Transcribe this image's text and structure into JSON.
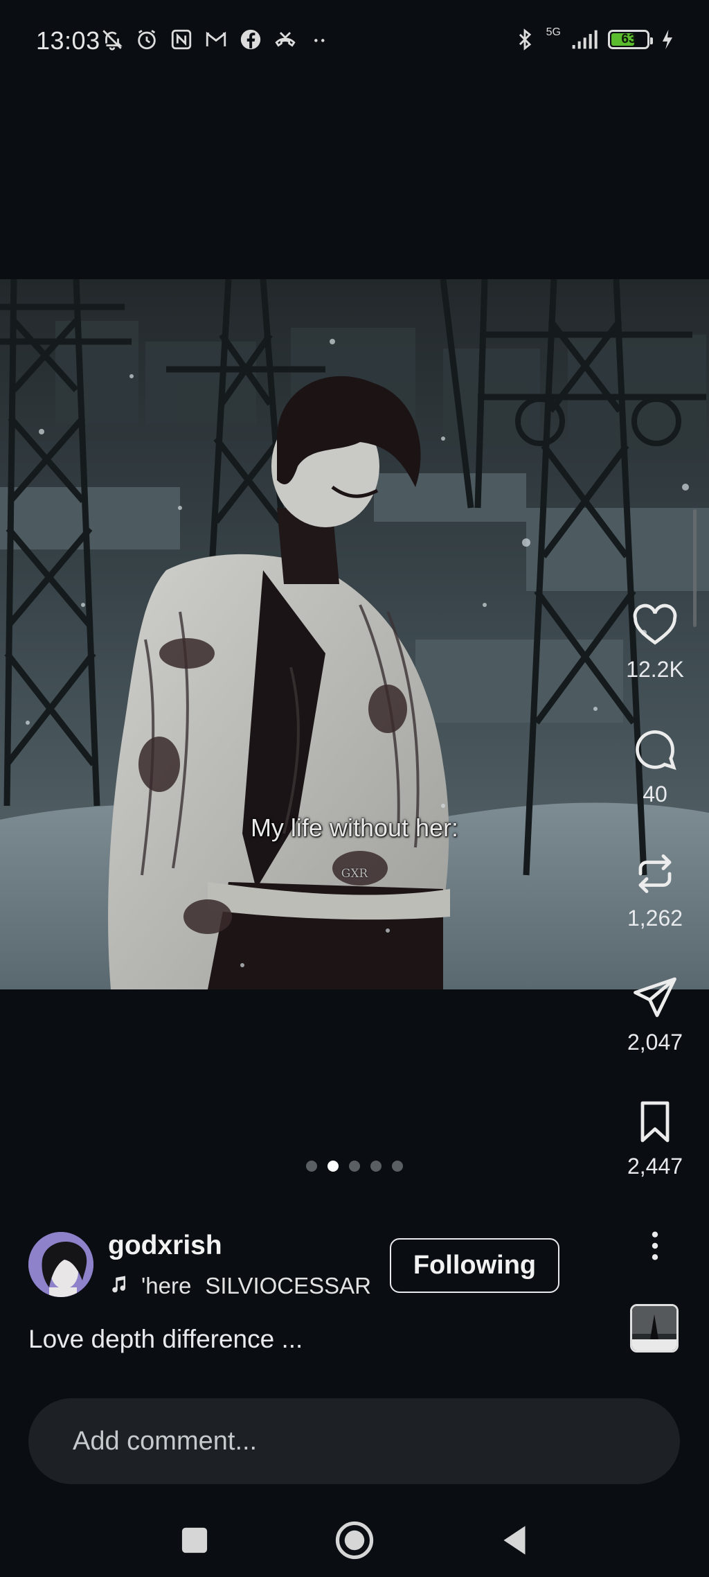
{
  "status_bar": {
    "time": "13:03",
    "network": "5G",
    "battery": "63",
    "left_icons": [
      "mute-bell-icon",
      "alarm-icon",
      "nfc-icon",
      "gmail-icon",
      "facebook-icon",
      "missed-call-icon",
      "more-notifications-icon"
    ],
    "right_icons": [
      "bluetooth-icon",
      "signal-icon",
      "battery-icon",
      "charging-icon"
    ]
  },
  "post": {
    "media_caption": "My life without her:",
    "watermark": "GXR",
    "pager": {
      "total": 5,
      "active_index": 1
    }
  },
  "actions": {
    "likes": "12.2K",
    "comments": "40",
    "reposts": "1,262",
    "shares": "2,047",
    "saves": "2,447"
  },
  "author": {
    "username": "godxrish",
    "music_title": "'here",
    "music_artist": "SILVIOCESSAR",
    "follow_label": "Following"
  },
  "caption": "Love depth difference ...",
  "comment_box": {
    "placeholder": "Add comment..."
  },
  "nav": [
    "recents-button",
    "home-button",
    "back-button"
  ],
  "colors": {
    "background": "#0a0e12",
    "battery_fill": "#5bbb2f",
    "comment_bar": "#1d2126"
  }
}
